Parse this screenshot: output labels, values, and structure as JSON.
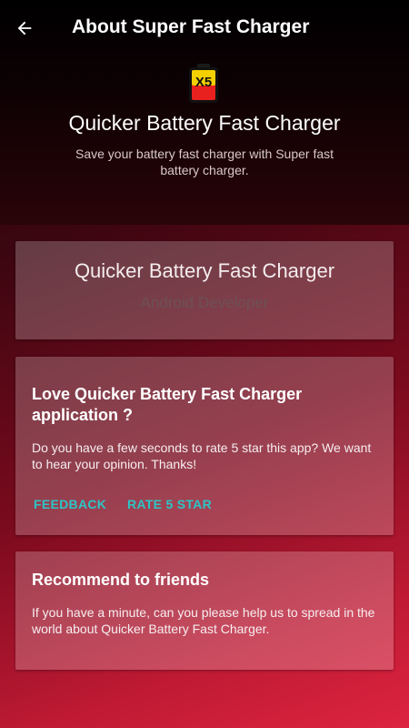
{
  "toolbar": {
    "title": "About Super Fast Charger",
    "back_icon": "arrow-left-icon"
  },
  "header": {
    "app_icon": "battery-x5-icon",
    "app_icon_text": "X5",
    "app_name": "Quicker Battery Fast Charger",
    "description": "Save your battery fast charger with Super fast battery charger."
  },
  "developer_card": {
    "app_name": "Quicker Battery Fast Charger",
    "developer": "Android Developer"
  },
  "rate_card": {
    "title": "Love Quicker Battery Fast Charger application ?",
    "body": "Do you have a few seconds to rate 5 star this app? We want to hear your opinion. Thanks!",
    "feedback_label": "FEEDBACK",
    "rate_label": "RATE 5 STAR"
  },
  "recommend_card": {
    "title": "Recommend to friends",
    "body": "If you have a minute, can you please help us to spread in the world about Quicker Battery Fast Charger."
  },
  "colors": {
    "accent": "#2ec4c6",
    "background_top": "#000000",
    "background_bottom": "#dd2440"
  }
}
